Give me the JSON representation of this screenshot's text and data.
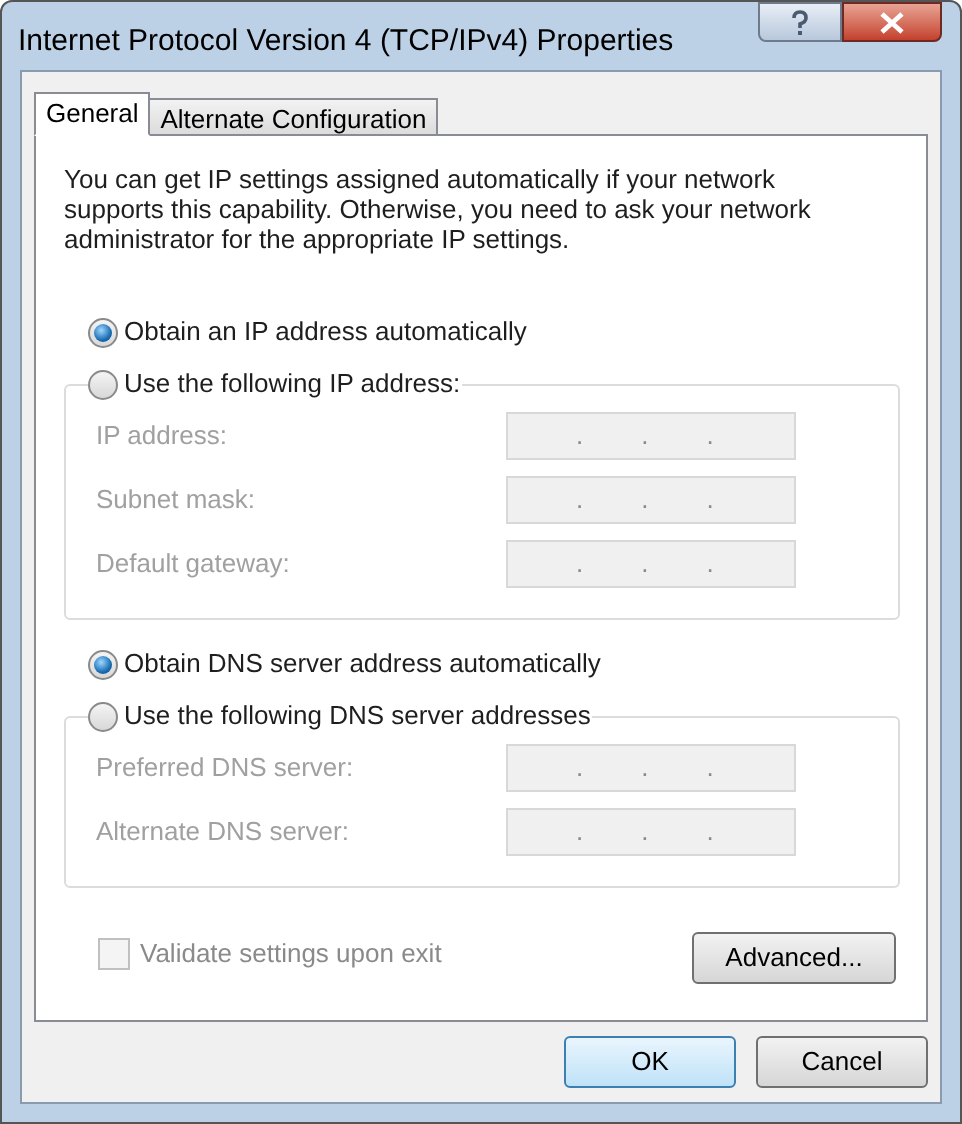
{
  "window": {
    "title": "Internet Protocol Version 4 (TCP/IPv4) Properties"
  },
  "tabs": [
    {
      "label": "General",
      "selected": true
    },
    {
      "label": "Alternate Configuration",
      "selected": false
    }
  ],
  "description": "You can get IP settings assigned automatically if your network supports this capability. Otherwise, you need to ask your network administrator for the appropriate IP settings.",
  "ip_section": {
    "auto_option": {
      "label": "Obtain an IP address automatically",
      "selected": true
    },
    "manual_option": {
      "label": "Use the following IP address:",
      "selected": false
    },
    "fields": [
      {
        "label": "IP address:",
        "disabled": true,
        "separators": [
          ".",
          ".",
          "."
        ]
      },
      {
        "label": "Subnet mask:",
        "disabled": true,
        "separators": [
          ".",
          ".",
          "."
        ]
      },
      {
        "label": "Default gateway:",
        "disabled": true,
        "separators": [
          ".",
          ".",
          "."
        ]
      }
    ]
  },
  "dns_section": {
    "auto_option": {
      "label": "Obtain DNS server address automatically",
      "selected": true
    },
    "manual_option": {
      "label": "Use the following DNS server addresses",
      "selected": false
    },
    "fields": [
      {
        "label": "Preferred DNS server:",
        "disabled": true,
        "separators": [
          ".",
          ".",
          "."
        ]
      },
      {
        "label": "Alternate DNS server:",
        "disabled": true,
        "separators": [
          ".",
          ".",
          "."
        ]
      }
    ]
  },
  "validate": {
    "label": "Validate settings upon exit",
    "checked": false,
    "disabled": true
  },
  "advanced_button": {
    "label": "Advanced..."
  },
  "buttons": [
    {
      "label": "OK",
      "default": true
    },
    {
      "label": "Cancel",
      "default": false
    }
  ]
}
